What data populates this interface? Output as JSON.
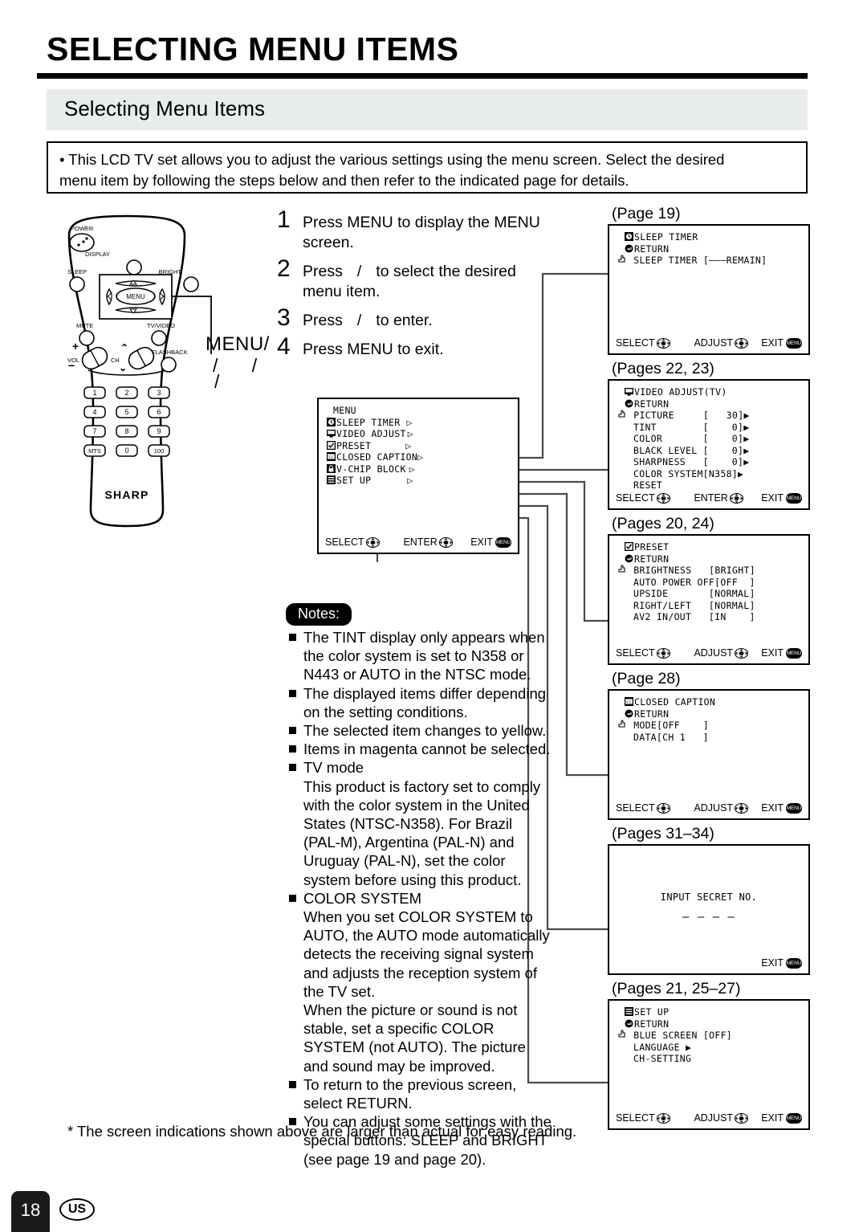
{
  "header": {
    "title": "SELECTING MENU ITEMS",
    "section": "Selecting Menu Items",
    "intro_line1": "• This LCD TV set allows you to adjust the various settings using the menu screen. Select the desired",
    "intro_line2": "menu item by following the steps below and then refer to the indicated page for details."
  },
  "remote": {
    "brand": "SHARP",
    "labels": {
      "power": "POWER",
      "display": "DISPLAY",
      "sleep": "SLEEP",
      "bright": "BRIGHT",
      "menu": "MENU",
      "mute": "MUTE",
      "tv_video": "TV/VIDEO",
      "flashback": "FLASHBACK",
      "vol": "VOL",
      "ch": "CH"
    },
    "keypad": [
      "1",
      "2",
      "3",
      "4",
      "5",
      "6",
      "7",
      "8",
      "9",
      "MTS",
      "0",
      "100"
    ],
    "callout": "MENU/",
    "callout_slashes_row1": "/  /",
    "callout_slashes_row2": "/"
  },
  "steps": [
    {
      "num": "1",
      "text_a": "Press MENU to display the MENU",
      "text_b": "screen."
    },
    {
      "num": "2",
      "text_a": "Press",
      "mid": "/",
      "text_b": "to select the desired",
      "text_c": "menu item."
    },
    {
      "num": "3",
      "text_a": "Press",
      "mid": "/",
      "text_b": "to enter.",
      "text_c": ""
    },
    {
      "num": "4",
      "text_a": "Press MENU to exit.",
      "text_b": "",
      "text_c": ""
    }
  ],
  "menu_screen": {
    "title": "MENU",
    "items": [
      {
        "label": "SLEEP TIMER",
        "icon": "clock-icon",
        "arrow": "▷"
      },
      {
        "label": "VIDEO ADJUST",
        "icon": "monitor-icon",
        "arrow": "▷"
      },
      {
        "label": "PRESET",
        "icon": "check-icon",
        "arrow": "▷"
      },
      {
        "label": "CLOSED CAPTION",
        "icon": "cc-icon",
        "arrow": "▷"
      },
      {
        "label": "V-CHIP BLOCK",
        "icon": "lock-icon",
        "arrow": "▷"
      },
      {
        "label": "SET UP",
        "icon": "list-icon",
        "arrow": "▷"
      }
    ],
    "footer": {
      "select": "SELECT",
      "enter": "ENTER",
      "exit": "EXIT",
      "exit_key": "MENU"
    }
  },
  "osd_screens": [
    {
      "caption": "(Page 19)",
      "header": "SLEEP TIMER",
      "return": "RETURN",
      "lines": [
        "SLEEP TIMER [———REMAIN]"
      ],
      "footer": {
        "left": "SELECT",
        "mid": "ADJUST",
        "right": "EXIT",
        "exit_key": "MENU"
      }
    },
    {
      "caption": "(Pages 22, 23)",
      "header": "VIDEO ADJUST(TV)",
      "return": "RETURN",
      "lines": [
        "PICTURE     [   30]▶",
        "TINT        [    0]▶",
        "COLOR       [    0]▶",
        "BLACK LEVEL [    0]▶",
        "SHARPNESS   [    0]▶",
        "COLOR SYSTEM[N358]▶",
        "RESET"
      ],
      "footer": {
        "left": "SELECT",
        "mid": "ENTER",
        "right": "EXIT",
        "exit_key": "MENU"
      }
    },
    {
      "caption": "(Pages 20, 24)",
      "header": "PRESET",
      "return": "RETURN",
      "lines": [
        "BRIGHTNESS   [BRIGHT]",
        "AUTO POWER OFF[OFF  ]",
        "UPSIDE       [NORMAL]",
        "RIGHT/LEFT   [NORMAL]",
        "AV2 IN/OUT   [IN    ]"
      ],
      "footer": {
        "left": "SELECT",
        "mid": "ADJUST",
        "right": "EXIT",
        "exit_key": "MENU"
      }
    },
    {
      "caption": "(Page 28)",
      "header": "CLOSED CAPTION",
      "return": "RETURN",
      "lines": [
        "MODE[OFF    ]",
        "DATA[CH 1   ]"
      ],
      "footer": {
        "left": "SELECT",
        "mid": "ADJUST",
        "right": "EXIT",
        "exit_key": "MENU"
      }
    },
    {
      "caption": "(Pages 31–34)",
      "header": "",
      "return": "",
      "center_line1": "INPUT SECRET NO.",
      "center_line2": "— — — —",
      "lines": [],
      "footer": {
        "left": "",
        "mid": "",
        "right": "EXIT",
        "exit_key": "MENU"
      }
    },
    {
      "caption": "(Pages 21, 25–27)",
      "header": "SET UP",
      "return": "RETURN",
      "lines": [
        "BLUE SCREEN [OFF]",
        "LANGUAGE ▶",
        "CH-SETTING"
      ],
      "footer": {
        "left": "SELECT",
        "mid": "ADJUST",
        "right": "EXIT",
        "exit_key": "MENU"
      }
    }
  ],
  "notes": {
    "badge": "Notes:",
    "items": [
      [
        "The TINT display only appears when",
        "the color system is set to N358 or",
        "N443 or AUTO in the NTSC mode."
      ],
      [
        "The displayed items differ depending",
        "on the setting conditions."
      ],
      [
        "The selected item changes to yellow."
      ],
      [
        "Items in magenta cannot be selected."
      ],
      [
        "TV mode",
        "This product is factory set to comply",
        "with the color system in the United",
        "States (NTSC-N358). For Brazil",
        "(PAL-M), Argentina (PAL-N) and",
        "Uruguay (PAL-N), set the color",
        "system before using this product."
      ],
      [
        "COLOR SYSTEM",
        "When you set COLOR SYSTEM to",
        "AUTO, the AUTO mode automatically",
        "detects the receiving signal system",
        "and adjusts the reception system of",
        "the TV set.",
        "When the picture or sound is not",
        "stable, set a specific COLOR",
        "SYSTEM (not AUTO). The picture",
        "and sound may be improved."
      ],
      [
        "To return to the previous screen,",
        "select RETURN."
      ],
      [
        "You can adjust some settings with the",
        "special buttons: SLEEP and BRIGHT",
        "(see page 19 and page 20)."
      ]
    ]
  },
  "footer": {
    "note": "* The screen indications shown above are larger than actual for easy reading.",
    "page_number": "18",
    "region": "US"
  },
  "colors": {
    "band": "#e9edea",
    "rule": "#000000",
    "connector": "#4a4a4a",
    "badge_bg": "#1a1a1a"
  }
}
